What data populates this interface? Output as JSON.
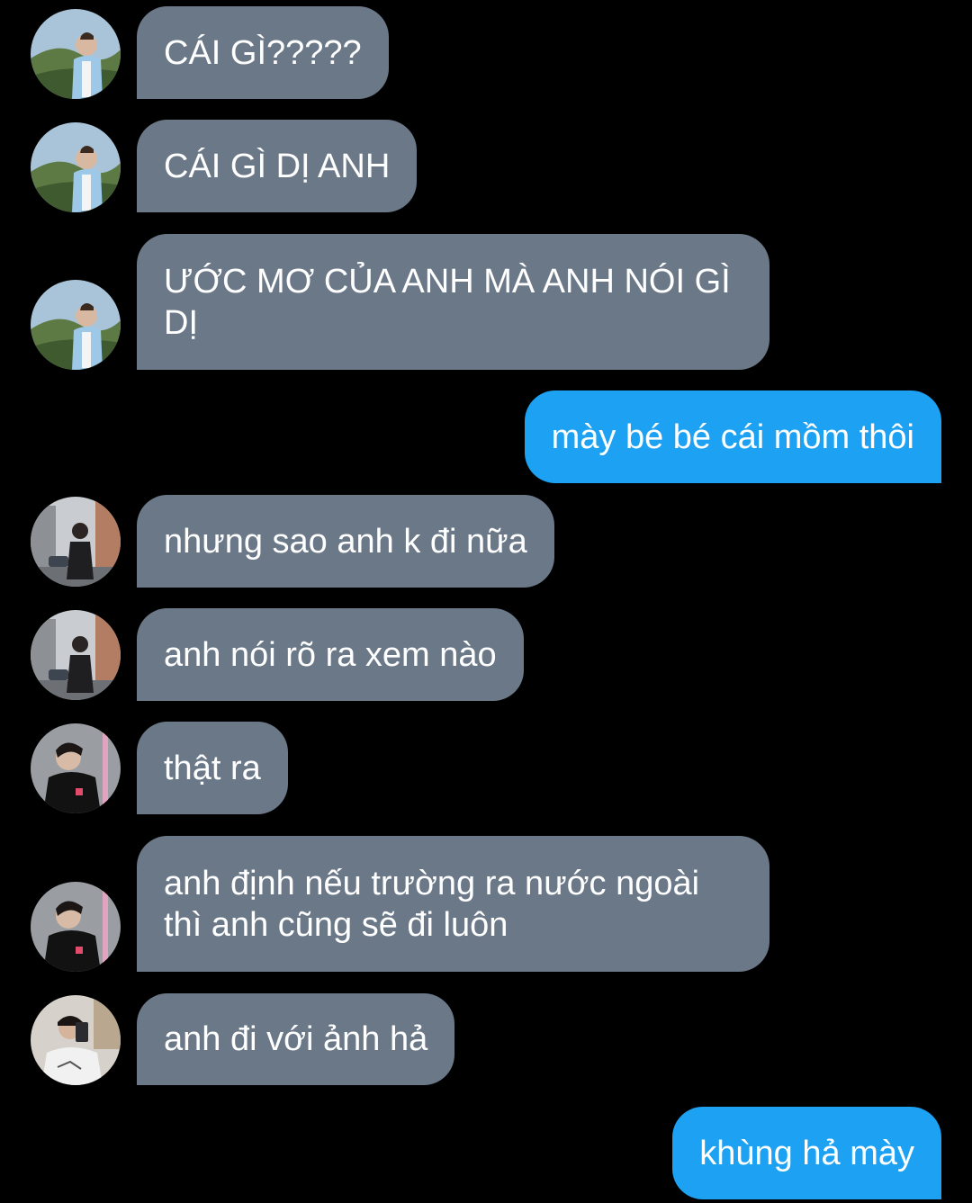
{
  "messages": [
    {
      "direction": "incoming",
      "sender_avatar": "avatar-1-outdoor-hill",
      "text": "CÁI GÌ?????"
    },
    {
      "direction": "incoming",
      "sender_avatar": "avatar-1-outdoor-hill",
      "text": "CÁI GÌ DỊ ANH"
    },
    {
      "direction": "incoming",
      "sender_avatar": "avatar-1-outdoor-hill",
      "text": "ƯỚC MƠ CỦA ANH MÀ ANH NÓI GÌ DỊ"
    },
    {
      "direction": "outgoing",
      "text": "mày bé bé cái mồm thôi"
    },
    {
      "direction": "incoming",
      "sender_avatar": "avatar-2-street",
      "text": "nhưng sao anh k đi nữa"
    },
    {
      "direction": "incoming",
      "sender_avatar": "avatar-2-street",
      "text": "anh nói rõ ra xem nào"
    },
    {
      "direction": "incoming",
      "sender_avatar": "avatar-3-black-shirt",
      "text": "thật ra"
    },
    {
      "direction": "incoming",
      "sender_avatar": "avatar-3-black-shirt",
      "text": "anh định nếu trường ra nước ngoài thì anh cũng sẽ đi luôn"
    },
    {
      "direction": "incoming",
      "sender_avatar": "avatar-4-mirror-selfie",
      "text": "anh đi với ảnh hả"
    },
    {
      "direction": "outgoing",
      "text": "khùng hả mày"
    }
  ],
  "colors": {
    "background": "#000000",
    "incoming_bubble": "#6a7888",
    "outgoing_bubble": "#1da1f2",
    "text": "#ffffff"
  }
}
